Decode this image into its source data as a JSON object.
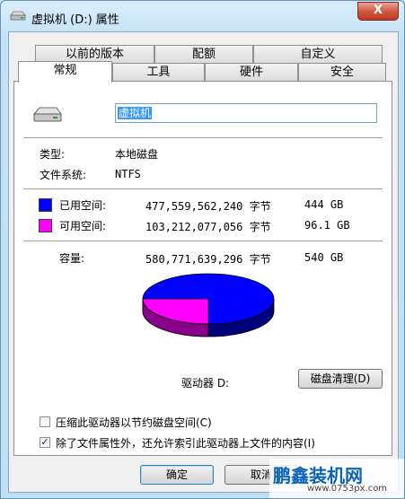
{
  "window": {
    "title": "虚拟机 (D:) 属性",
    "close_label": "X"
  },
  "tabs_row1": [
    {
      "label": "以前的版本"
    },
    {
      "label": "配额"
    },
    {
      "label": "自定义"
    }
  ],
  "tabs_row2": [
    {
      "label": "常规",
      "active": true
    },
    {
      "label": "工具"
    },
    {
      "label": "硬件"
    },
    {
      "label": "安全"
    }
  ],
  "general": {
    "volume_name": "虚拟机",
    "type_label": "类型:",
    "type_value": "本地磁盘",
    "fs_label": "文件系统:",
    "fs_value": "NTFS",
    "used": {
      "label": "已用空间:",
      "bytes": "477,559,562,240 字节",
      "size": "444 GB",
      "color": "#0000ff"
    },
    "free": {
      "label": "可用空间:",
      "bytes": "103,212,077,056 字节",
      "size": "96.1 GB",
      "color": "#ff00ff"
    },
    "capacity": {
      "label": "容量:",
      "bytes": "580,771,639,296 字节",
      "size": "540 GB"
    },
    "drive_label": "驱动器 D:",
    "cleanup_button": "磁盘清理(D)",
    "compress_option": {
      "label": "压缩此驱动器以节约磁盘空间(C)",
      "checked": false
    },
    "index_option": {
      "label": "除了文件属性外，还允许索引此驱动器上文件的内容(I)",
      "checked": true
    }
  },
  "buttons": {
    "ok": "确定",
    "cancel": "取消"
  },
  "watermark": {
    "brand": "鹏鑫装机网",
    "url": "www.0753px.com"
  }
}
